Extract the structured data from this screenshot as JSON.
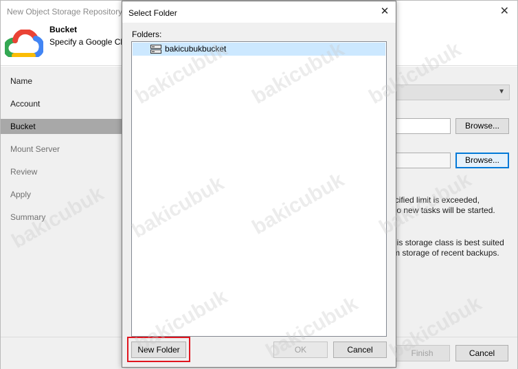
{
  "wizard": {
    "title": "New Object Storage Repository",
    "close_glyph": "✕",
    "header_title": "Bucket",
    "header_subtitle": "Specify a Google Cloud",
    "nav": [
      {
        "label": "Name"
      },
      {
        "label": "Account"
      },
      {
        "label": "Bucket"
      },
      {
        "label": "Mount Server"
      },
      {
        "label": "Review"
      },
      {
        "label": "Apply"
      },
      {
        "label": "Summary"
      }
    ],
    "browse1_label": "Browse...",
    "browse2_label": "Browse...",
    "text_line1": "ecified limit is exceeded,",
    "text_line2": "t no new tasks will be started.",
    "text_line3": "his storage class is best suited",
    "text_line4": "rm storage of recent backups.",
    "finish_label": "Finish",
    "cancel_label": "Cancel"
  },
  "dialog": {
    "title": "Select Folder",
    "close_glyph": "✕",
    "folders_label": "Folders:",
    "folders": [
      {
        "name": "bakicubukbucket",
        "selected": true
      }
    ],
    "new_folder_label": "New Folder",
    "ok_label": "OK",
    "cancel_label": "Cancel"
  },
  "watermark": "bakicubuk",
  "colors": {
    "selection": "#cce8ff",
    "focus_border": "#0078d7",
    "highlight": "#e0141e",
    "nav_active": "#a8a8a8"
  }
}
